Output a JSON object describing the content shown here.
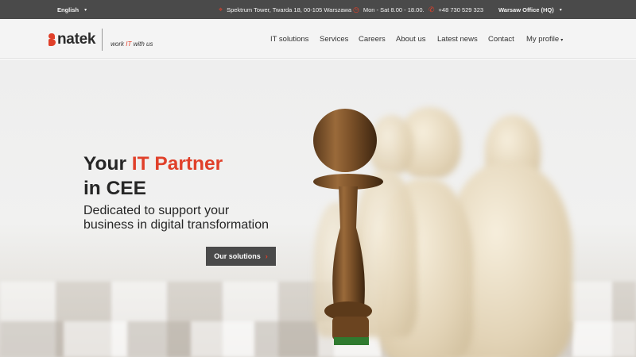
{
  "topbar": {
    "language": "English",
    "address": "Spektrum Tower, Twarda 18, 00-105 Warszawa",
    "hours": "Mon - Sat 8.00 - 18.00.",
    "phone": "+48 730 529 323",
    "office": "Warsaw Office (HQ)",
    "caret": "▾"
  },
  "header": {
    "logo_text": "natek",
    "tagline_pre": "work",
    "tagline_it": "IT",
    "tagline_post": "with us",
    "nav": [
      "IT solutions",
      "Services",
      "Careers",
      "About us",
      "Latest news",
      "Contact",
      "My profile"
    ]
  },
  "hero": {
    "title_pre": "Your ",
    "title_accent": "IT Partner",
    "title_line2": "in CEE",
    "subtitle_line1": "Dedicated to support your",
    "subtitle_line2": "business in digital transformation",
    "cta_label": "Our solutions",
    "cta_arrow": "›"
  },
  "colors": {
    "accent": "#e0402a",
    "topbar": "#4a4a4a",
    "header_bg": "#f4f4f4",
    "text": "#262626"
  }
}
